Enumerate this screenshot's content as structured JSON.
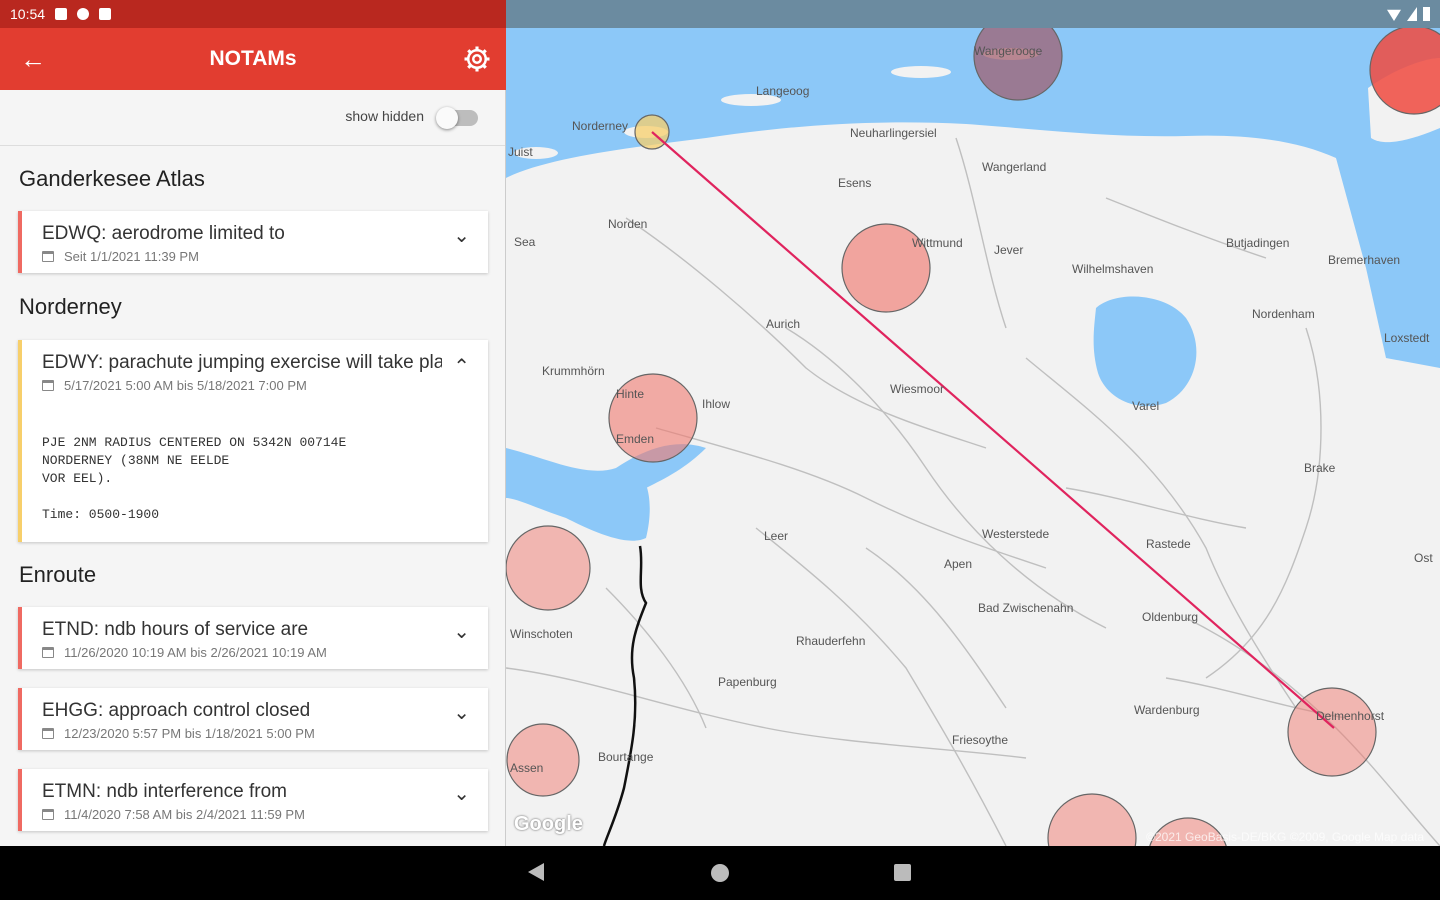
{
  "status_bar": {
    "time": "10:54"
  },
  "app_bar": {
    "title": "NOTAMs"
  },
  "filter": {
    "show_hidden_label": "show hidden",
    "show_hidden_on": false
  },
  "sections": [
    {
      "title": "Ganderkesee Atlas",
      "notams": [
        {
          "title": "EDWQ: aerodrome limited to",
          "date": "Seit 1/1/2021 11:39 PM",
          "expanded": false
        }
      ]
    },
    {
      "title": "Norderney",
      "notams": [
        {
          "title": "EDWY: parachute jumping exercise will take place",
          "date": "5/17/2021 5:00 AM bis 5/18/2021 7:00 PM",
          "expanded": true,
          "detail_lines": [
            "PJE 2NM RADIUS CENTERED ON 5342N 00714E",
            "NORDERNEY (38NM NE EELDE",
            "VOR EEL)."
          ],
          "time": "Time: 0500-1900"
        }
      ]
    },
    {
      "title": "Enroute",
      "notams": [
        {
          "title": "ETND: ndb hours of service are",
          "date": "11/26/2020 10:19 AM bis 2/26/2021 10:19 AM",
          "expanded": false
        },
        {
          "title": "EHGG: approach control closed",
          "date": "12/23/2020 5:57 PM bis 1/18/2021 5:00 PM",
          "expanded": false
        },
        {
          "title": "ETMN: ndb interference from",
          "date": "11/4/2020 7:58 AM bis 2/4/2021 11:59 PM",
          "expanded": false
        }
      ]
    }
  ],
  "map": {
    "labels": [
      "Wangerooge",
      "Langeoog",
      "Norderney",
      "Juist",
      "Neuharlingersiel",
      "Wangerland",
      "Esens",
      "Norden",
      "Wittmund",
      "Jever",
      "Wilhelmshaven",
      "Butjadingen",
      "Bremerhaven",
      "Nordenham",
      "Aurich",
      "Krummhörn",
      "Hinte",
      "Ihlow",
      "Emden",
      "Wiesmoor",
      "Varel",
      "Brake",
      "Loxstedt",
      "Leer",
      "Westerstede",
      "Rastede",
      "Apen",
      "Bad Zwischenahn",
      "Oldenburg",
      "Winschoten",
      "Rhauderfehn",
      "Papenburg",
      "Wardenburg",
      "Delmenhorst",
      "Friesoythe",
      "Bourtange",
      "Ost",
      "Assen",
      "Sea"
    ],
    "attribution": "Google",
    "copyright": "©2021 GeoBasis-DE/BKG ©2009, Google Map data",
    "colors": {
      "water": "#8cc8f8",
      "land": "#f2f2f2",
      "circle": "#f07a70",
      "route": "#e0245e"
    }
  },
  "nav": {
    "back": "back-icon",
    "home": "home-icon",
    "recents": "recents-icon"
  }
}
